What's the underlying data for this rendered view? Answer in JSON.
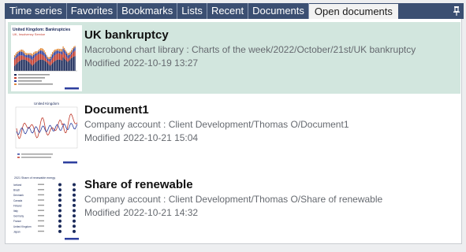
{
  "tabs": [
    {
      "label": "Time series"
    },
    {
      "label": "Favorites"
    },
    {
      "label": "Bookmarks"
    },
    {
      "label": "Lists"
    },
    {
      "label": "Recent"
    },
    {
      "label": "Documents"
    },
    {
      "label": "Open documents",
      "active": true
    }
  ],
  "pin_icon": "pin-icon",
  "documents": [
    {
      "title": "UK bankruptcy",
      "path": "Macrobond chart library : Charts of the week/2022/October/21st/UK bankruptcy",
      "modified_label": "Modified",
      "modified_date": "2022-10-19 13:27",
      "thumb_title": "United Kingdom: Bankruptcies",
      "thumb_subtitle": "UK, Insolvency Service",
      "selected": true
    },
    {
      "title": "Document1",
      "path": "Company account : Client Development/Thomas O/Document1",
      "modified_label": "Modified",
      "modified_date": "2022-10-21 15:04",
      "thumb_title": "United Kingdom",
      "selected": false
    },
    {
      "title": "Share of renewable",
      "path": "Company account : Client Development/Thomas O/Share of renewable",
      "modified_label": "Modified",
      "modified_date": "2022-10-21 14:32",
      "thumb_title": "2021 Share of renewable energy",
      "thumb_rows": [
        "Iceland",
        "Brazil",
        "Denmark",
        "Canada",
        "Finland",
        "Italy",
        "Germany",
        "France",
        "United Kingdom",
        "Japan"
      ],
      "selected": false
    }
  ],
  "colors": {
    "tabbar": "#3b4f72",
    "selected_row": "#d2e6de",
    "accent_red": "#c0392b",
    "accent_blue": "#2c3e9e"
  }
}
